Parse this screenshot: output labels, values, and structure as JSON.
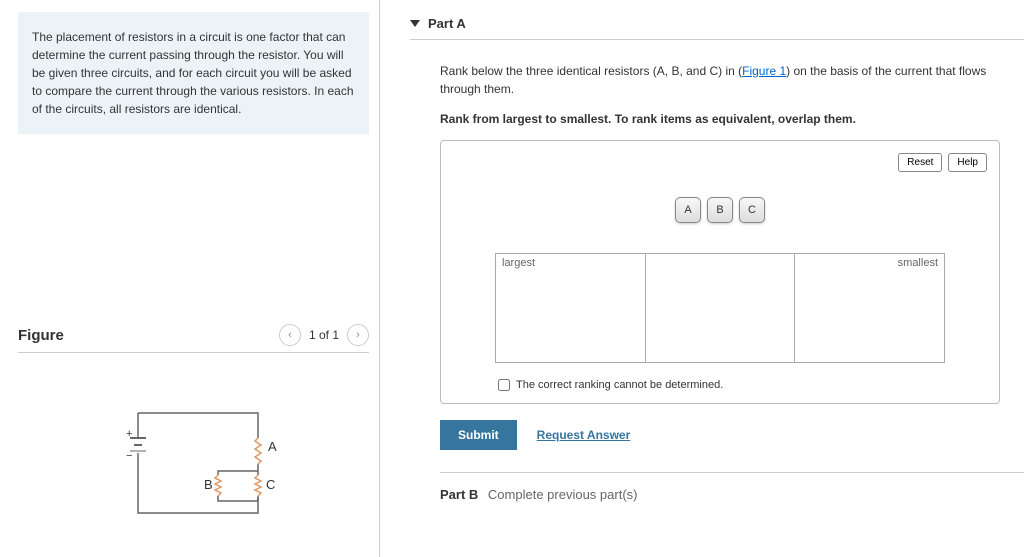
{
  "problem_text": "The placement of resistors in a circuit is one factor that can determine the current passing through the resistor. You will be given three circuits, and for each circuit you will be asked to compare the current through the various resistors. In each of the circuits, all resistors are identical.",
  "figure": {
    "title": "Figure",
    "nav_text": "1 of 1",
    "labels": {
      "a": "A",
      "b": "B",
      "c": "C",
      "plus": "+",
      "minus": "−"
    }
  },
  "part_a": {
    "title": "Part A",
    "question_pre": "Rank below the three identical resistors (A, B, and C) in (",
    "figure_link": "Figure 1",
    "question_post": ") on the basis of the current that flows through them.",
    "instruction": "Rank from largest to smallest. To rank items as equivalent, overlap them.",
    "reset": "Reset",
    "help": "Help",
    "items": [
      "A",
      "B",
      "C"
    ],
    "label_largest": "largest",
    "label_smallest": "smallest",
    "cannot_determine": "The correct ranking cannot be determined.",
    "submit": "Submit",
    "request_answer": "Request Answer"
  },
  "part_b": {
    "label": "Part B",
    "text": "Complete previous part(s)"
  }
}
